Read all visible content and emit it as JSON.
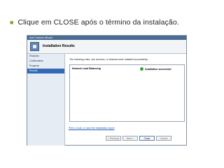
{
  "slide": {
    "bullet_text": "Clique em CLOSE após o término da instalação."
  },
  "wizard": {
    "window_title": "Add Features Wizard",
    "banner_title": "Installation Results",
    "nav_items": [
      {
        "label": "Features"
      },
      {
        "label": "Confirmation"
      },
      {
        "label": "Progress"
      },
      {
        "label": "Results"
      }
    ],
    "content_message": "The following roles, role services, or features were installed successfully:",
    "result": {
      "name": "Network Load Balancing",
      "status": "Installation succeeded"
    },
    "link_text": "Print, e-mail, or save the installation report",
    "buttons": {
      "previous": "< Previous",
      "next": "Next >",
      "close": "Close",
      "cancel": "Cancel"
    }
  },
  "colors": {
    "bullet": "#8aa12a",
    "active_nav": "#3369b7",
    "success": "#3aa23a"
  }
}
